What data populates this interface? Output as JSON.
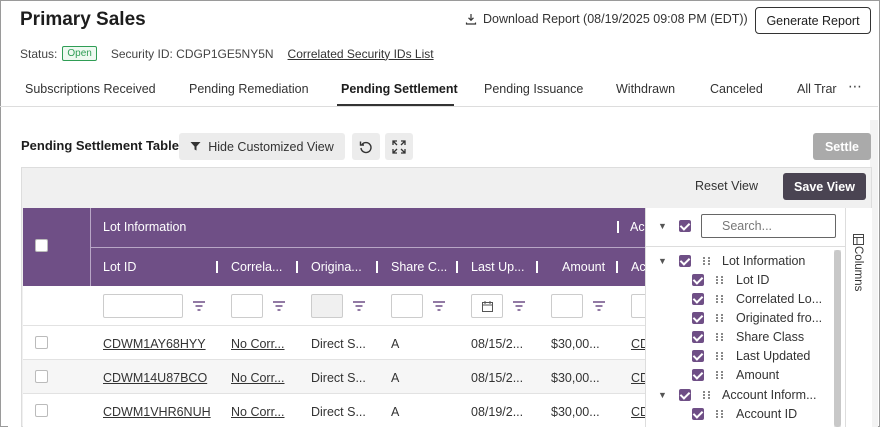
{
  "header": {
    "title": "Primary Sales",
    "download_label": "Download Report (08/19/2025 09:08 PM (EDT))",
    "generate_label": "Generate Report"
  },
  "status": {
    "label": "Status:",
    "badge": "Open",
    "security_id_label": "Security ID: CDGP1GE5NY5N",
    "correlated_link": "Correlated Security IDs List"
  },
  "tabs": [
    {
      "label": "Subscriptions Received"
    },
    {
      "label": "Pending Remediation"
    },
    {
      "label": "Pending Settlement",
      "active": true
    },
    {
      "label": "Pending Issuance"
    },
    {
      "label": "Withdrawn"
    },
    {
      "label": "Canceled"
    },
    {
      "label": "All Trar"
    }
  ],
  "more_icon": "ellipsis-icon",
  "toolbar": {
    "table_title": "Pending Settlement Table",
    "hide_label": "Hide Customized View",
    "settle_label": "Settle",
    "reset_label": "Reset View",
    "save_label": "Save View"
  },
  "table": {
    "group_headers": [
      "Lot Information",
      "Ac"
    ],
    "columns": [
      "Lot ID",
      "Correla...",
      "Origina...",
      "Share C...",
      "Last Up...",
      "Amount",
      "Ac"
    ],
    "rows": [
      [
        "CDWM1AY68HYY",
        "No Corr...",
        "Direct S...",
        "A",
        "08/15/2...",
        "$30,00...",
        "CD"
      ],
      [
        "CDWM14U87BCO",
        "No Corr...",
        "Direct S...",
        "A",
        "08/15/2...",
        "$30,00...",
        "CD"
      ],
      [
        "CDWM1VHR6NUH",
        "No Corr...",
        "Direct S...",
        "A",
        "08/19/2...",
        "$30,00...",
        "CD"
      ]
    ]
  },
  "column_panel": {
    "search_placeholder": "Search...",
    "side_tab_label": "Columns",
    "items": [
      {
        "label": "Lot Information",
        "group": true
      },
      {
        "label": "Lot ID"
      },
      {
        "label": "Correlated Lo..."
      },
      {
        "label": "Originated fro..."
      },
      {
        "label": "Share Class"
      },
      {
        "label": "Last Updated"
      },
      {
        "label": "Amount"
      },
      {
        "label": "Account Inform...",
        "group": true
      },
      {
        "label": "Account ID"
      }
    ]
  },
  "colors": {
    "header_purple": "#6f4f86",
    "open_badge_green": "#2f9d55",
    "save_button": "#4a4452"
  }
}
